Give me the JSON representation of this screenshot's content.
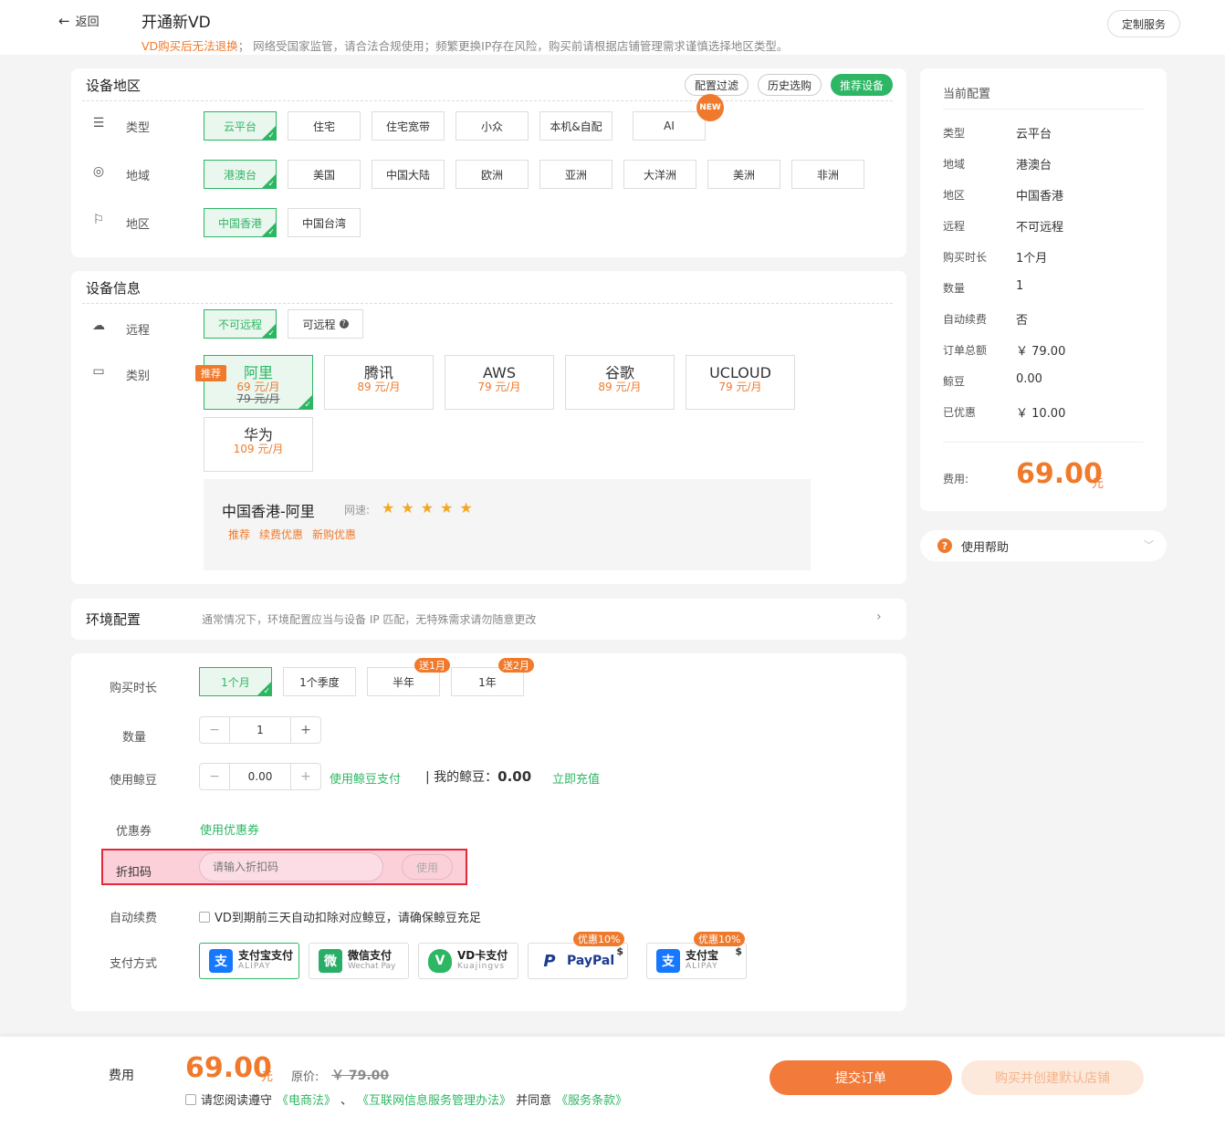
{
  "header": {
    "back_label": "返回",
    "title": "开通新VD",
    "notice_highlight": "VD购买后无法退换",
    "notice_rest": "； 网络受国家监管，请合法合规使用；频繁更换IP存在风险，购买前请根据店铺管理需求谨慎选择地区类型。",
    "custom_service": "定制服务"
  },
  "region_card": {
    "title": "设备地区",
    "filter_label": "配置过滤",
    "history_label": "历史选购",
    "recommend_label": "推荐设备",
    "type_label": "类型",
    "types": [
      "云平台",
      "住宅",
      "住宅宽带",
      "小众",
      "本机&自配",
      "AI"
    ],
    "new_badge": "NEW",
    "area_label": "地域",
    "areas": [
      "港澳台",
      "美国",
      "中国大陆",
      "欧洲",
      "亚洲",
      "大洋洲",
      "美洲",
      "非洲"
    ],
    "region_label": "地区",
    "regions": [
      "中国香港",
      "中国台湾"
    ]
  },
  "device_card": {
    "title": "设备信息",
    "remote_label": "远程",
    "remote_options": [
      "不可远程",
      "可远程"
    ],
    "category_label": "类别",
    "rec_tag": "推荐",
    "vendors": [
      {
        "name": "阿里",
        "price": "69 元/月",
        "old": "79 元/月"
      },
      {
        "name": "腾讯",
        "price": "89 元/月"
      },
      {
        "name": "AWS",
        "price": "79 元/月"
      },
      {
        "name": "谷歌",
        "price": "89 元/月"
      },
      {
        "name": "UCLOUD",
        "price": "79 元/月"
      },
      {
        "name": "华为",
        "price": "109 元/月"
      }
    ],
    "detail_title": "中国香港-阿里",
    "speed_label": "网速:",
    "speed_stars": 5,
    "detail_tags": [
      "推荐",
      "续费优惠",
      "新购优惠"
    ]
  },
  "env_card": {
    "title": "环境配置",
    "desc": "通常情况下，环境配置应当与设备 IP 匹配，无特殊需求请勿随意更改"
  },
  "purchase_card": {
    "duration_label": "购买时长",
    "durations": [
      {
        "label": "1个月",
        "promo": ""
      },
      {
        "label": "1个季度",
        "promo": ""
      },
      {
        "label": "半年",
        "promo": "送1月"
      },
      {
        "label": "1年",
        "promo": "送2月"
      }
    ],
    "quantity_label": "数量",
    "quantity": "1",
    "beans_label": "使用鲸豆",
    "beans_value": "0.00",
    "beans_pay": "使用鲸豆支付",
    "my_beans_label": "我的鲸豆：",
    "my_beans": "0.00",
    "recharge": "立即充值",
    "coupon_label": "优惠券",
    "coupon_link": "使用优惠券",
    "discount_label": "折扣码",
    "discount_placeholder": "请输入折扣码",
    "discount_use": "使用",
    "autorenew_label": "自动续费",
    "autorenew_text": "VD到期前三天自动扣除对应鲸豆，请确保鲸豆充足",
    "payment_label": "支付方式",
    "payments": [
      {
        "t1": "支付宝支付",
        "t2": "ALIPAY",
        "promo": "",
        "icon": "支"
      },
      {
        "t1": "微信支付",
        "t2": "Wechat Pay",
        "promo": "",
        "icon": "微"
      },
      {
        "t1": "VD卡支付",
        "t2": "Kuajingvs",
        "promo": "",
        "icon": "V"
      },
      {
        "t1": "PayPal",
        "t2": "",
        "promo": "优惠10%",
        "icon": "P"
      },
      {
        "t1": "支付宝",
        "t2": "ALIPAY",
        "promo": "优惠10%",
        "icon": "支"
      }
    ],
    "dollar": "$"
  },
  "summary": {
    "title": "当前配置",
    "rows": [
      {
        "k": "类型",
        "v": "云平台"
      },
      {
        "k": "地域",
        "v": "港澳台"
      },
      {
        "k": "地区",
        "v": "中国香港"
      },
      {
        "k": "远程",
        "v": "不可远程"
      },
      {
        "k": "购买时长",
        "v": "1个月"
      },
      {
        "k": "数量",
        "v": "1"
      },
      {
        "k": "自动续费",
        "v": "否"
      },
      {
        "k": "订单总额",
        "v": "￥ 79.00"
      },
      {
        "k": "鲸豆",
        "v": "0.00"
      },
      {
        "k": "已优惠",
        "v": "￥ 10.00"
      }
    ],
    "fee_label": "费用:",
    "fee": "69.00",
    "unit": "元",
    "help_label": "使用帮助"
  },
  "footer": {
    "fee_label": "费用",
    "fee": "69.00",
    "unit": "元",
    "orig_label": "原价:",
    "orig": "￥ 79.00",
    "agree_prefix": "请您阅读遵守",
    "law1": "《电商法》",
    "sep": "、",
    "law2": "《互联网信息服务管理办法》",
    "agree_mid": "并同意",
    "law3": "《服务条款》",
    "submit": "提交订单",
    "buy_create": "购买并创建默认店铺"
  },
  "colors": {
    "accent": "#2db663",
    "orange": "#f07a2c",
    "highlight_box": "#e0293b"
  }
}
